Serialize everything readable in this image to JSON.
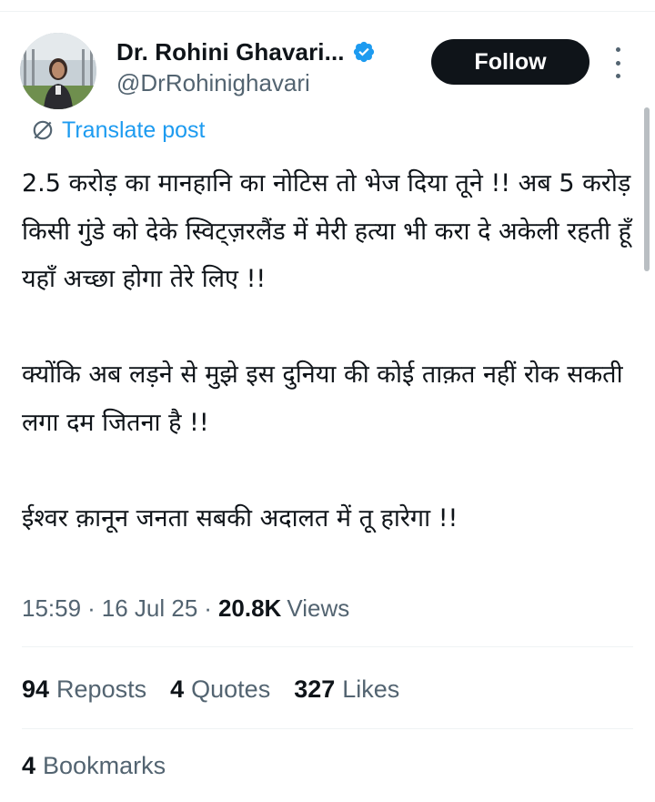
{
  "author": {
    "display_name": "Dr. Rohini Ghavari...",
    "handle": "@DrRohinighavari",
    "verified": true,
    "avatar": "profile-photo"
  },
  "follow_label": "Follow",
  "more_icon": "more-vertical-icon",
  "translate_label": "Translate post",
  "post_paragraphs": [
    "2.5 करोड़ का मानहानि का नोटिस तो भेज दिया तूने !! अब 5 करोड़ किसी गुंडे को देके स्विट्ज़रलैंड में मेरी हत्या भी करा दे अकेली रहती हूँ यहाँ अच्छा होगा तेरे लिए !!",
    "क्योंकि अब लड़ने से मुझे इस दुनिया की कोई ताक़त नहीं रोक सकती लगा दम जितना है !!",
    "ईश्वर क़ानून जनता सबकी अदालत में तू हारेगा !!"
  ],
  "meta": {
    "time": "15:59",
    "date": "16 Jul 25",
    "views_count": "20.8K",
    "views_label": "Views"
  },
  "stats": {
    "reposts": {
      "count": "94",
      "label": "Reposts"
    },
    "quotes": {
      "count": "4",
      "label": "Quotes"
    },
    "likes": {
      "count": "327",
      "label": "Likes"
    },
    "bookmarks": {
      "count": "4",
      "label": "Bookmarks"
    }
  },
  "colors": {
    "accent": "#1d9bf0",
    "text": "#0f1419",
    "secondary": "#536471",
    "divider": "#eff3f4",
    "button": "#0f1419"
  }
}
